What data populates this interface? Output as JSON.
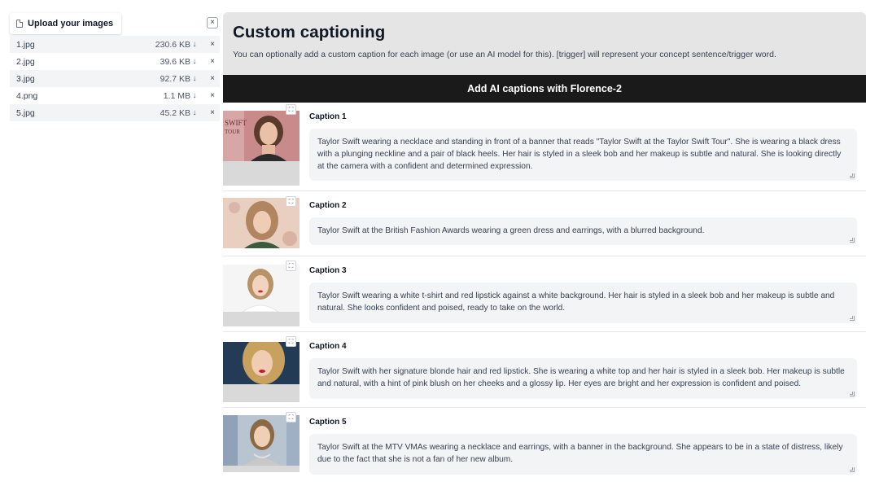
{
  "upload": {
    "button_label": "Upload your images",
    "button_icon": "file-icon",
    "close_label": "×",
    "files": [
      {
        "name": "1.jpg",
        "size": "230.6 KB",
        "download": "↓",
        "remove": "×"
      },
      {
        "name": "2.jpg",
        "size": "39.6 KB",
        "download": "↓",
        "remove": "×"
      },
      {
        "name": "3.jpg",
        "size": "92.7 KB",
        "download": "↓",
        "remove": "×"
      },
      {
        "name": "4.png",
        "size": "1.1 MB",
        "download": "↓",
        "remove": "×"
      },
      {
        "name": "5.jpg",
        "size": "45.2 KB",
        "download": "↓",
        "remove": "×"
      }
    ]
  },
  "main": {
    "title": "Custom captioning",
    "description": "You can optionally add a custom caption for each image (or use an AI model for this). [trigger] will represent your concept sentence/trigger word.",
    "ai_button": "Add AI captions with Florence-2",
    "expand_icon": "⛶",
    "captions": [
      {
        "label": "Caption 1",
        "text": "Taylor Swift wearing a necklace and standing in front of a banner that reads \"Taylor Swift at the Taylor Swift Tour\". She is wearing a black dress with a plunging neckline and a pair of black heels. Her hair is styled in a sleek bob and her makeup is subtle and natural. She is looking directly at the camera with a confident and determined expression."
      },
      {
        "label": "Caption 2",
        "text": "Taylor Swift at the British Fashion Awards wearing a green dress and earrings, with a blurred background."
      },
      {
        "label": "Caption 3",
        "text": "Taylor Swift wearing a white t-shirt and red lipstick against a white background. Her hair is styled in a sleek bob and her makeup is subtle and natural. She looks confident and poised, ready to take on the world."
      },
      {
        "label": "Caption 4",
        "text": "Taylor Swift with her signature blonde hair and red lipstick. She is wearing a white top and her hair is styled in a sleek bob. Her makeup is subtle and natural, with a hint of pink blush on her cheeks and a glossy lip. Her eyes are bright and her expression is confident and poised."
      },
      {
        "label": "Caption 5",
        "text": "Taylor Swift at the MTV VMAs wearing a necklace and earrings, with a banner in the background. She appears to be in a state of distress, likely due to the fact that she is not a fan of her new album."
      }
    ]
  },
  "colors": {
    "header_bg": "#e5e5e5",
    "ai_button_bg": "#1a1a1a",
    "caption_box_bg": "#f3f4f6"
  }
}
